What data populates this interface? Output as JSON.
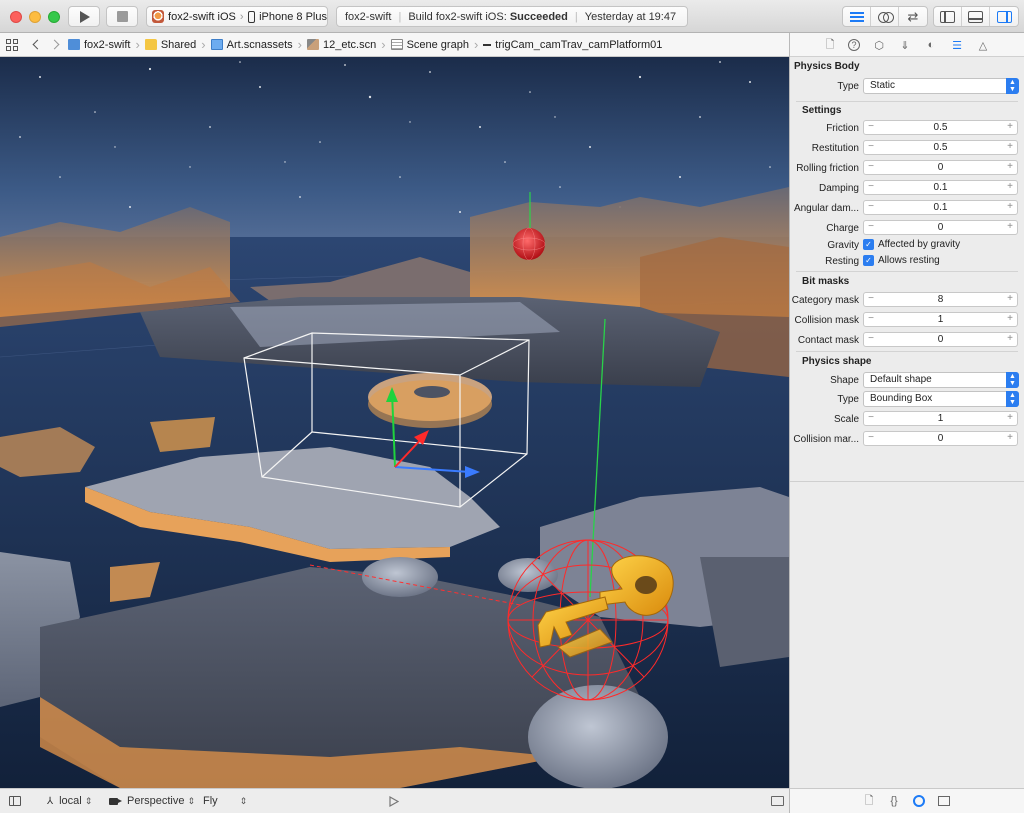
{
  "toolbar": {
    "scheme_name": "fox2-swift iOS",
    "device_name": "iPhone 8 Plus",
    "activity_project": "fox2-swift",
    "activity_prefix": "Build fox2-swift iOS:",
    "activity_status": "Succeeded",
    "activity_time": "Yesterday at 19:47"
  },
  "jumpbar": {
    "crumbs": [
      "fox2-swift",
      "Shared",
      "Art.scnassets",
      "12_etc.scn",
      "Scene graph",
      "trigCam_camTrav_camPlatform01"
    ]
  },
  "viewport": {
    "orientation": "local",
    "camera": "Perspective",
    "navigation": "Fly"
  },
  "inspector": {
    "physics_body_title": "Physics Body",
    "type_label": "Type",
    "type_value": "Static",
    "settings_title": "Settings",
    "friction_label": "Friction",
    "friction_value": "0.5",
    "restitution_label": "Restitution",
    "restitution_value": "0.5",
    "rolling_friction_label": "Rolling friction",
    "rolling_friction_value": "0",
    "damping_label": "Damping",
    "damping_value": "0.1",
    "angular_damping_label": "Angular dam...",
    "angular_damping_value": "0.1",
    "charge_label": "Charge",
    "charge_value": "0",
    "gravity_label": "Gravity",
    "gravity_check": "Affected by gravity",
    "resting_label": "Resting",
    "resting_check": "Allows resting",
    "bit_masks_title": "Bit masks",
    "category_mask_label": "Category mask",
    "category_mask_value": "8",
    "collision_mask_label": "Collision mask",
    "collision_mask_value": "1",
    "contact_mask_label": "Contact mask",
    "contact_mask_value": "0",
    "physics_shape_title": "Physics shape",
    "shape_label": "Shape",
    "shape_value": "Default shape",
    "shape_type_label": "Type",
    "shape_type_value": "Bounding Box",
    "scale_label": "Scale",
    "scale_value": "1",
    "collision_margin_label": "Collision mar...",
    "collision_margin_value": "0"
  },
  "colors": {
    "accent": "#2b7df0",
    "selection_box": "#ffffff",
    "physics_wireframe": "#ff2a2a",
    "key": "#f2b21c"
  }
}
